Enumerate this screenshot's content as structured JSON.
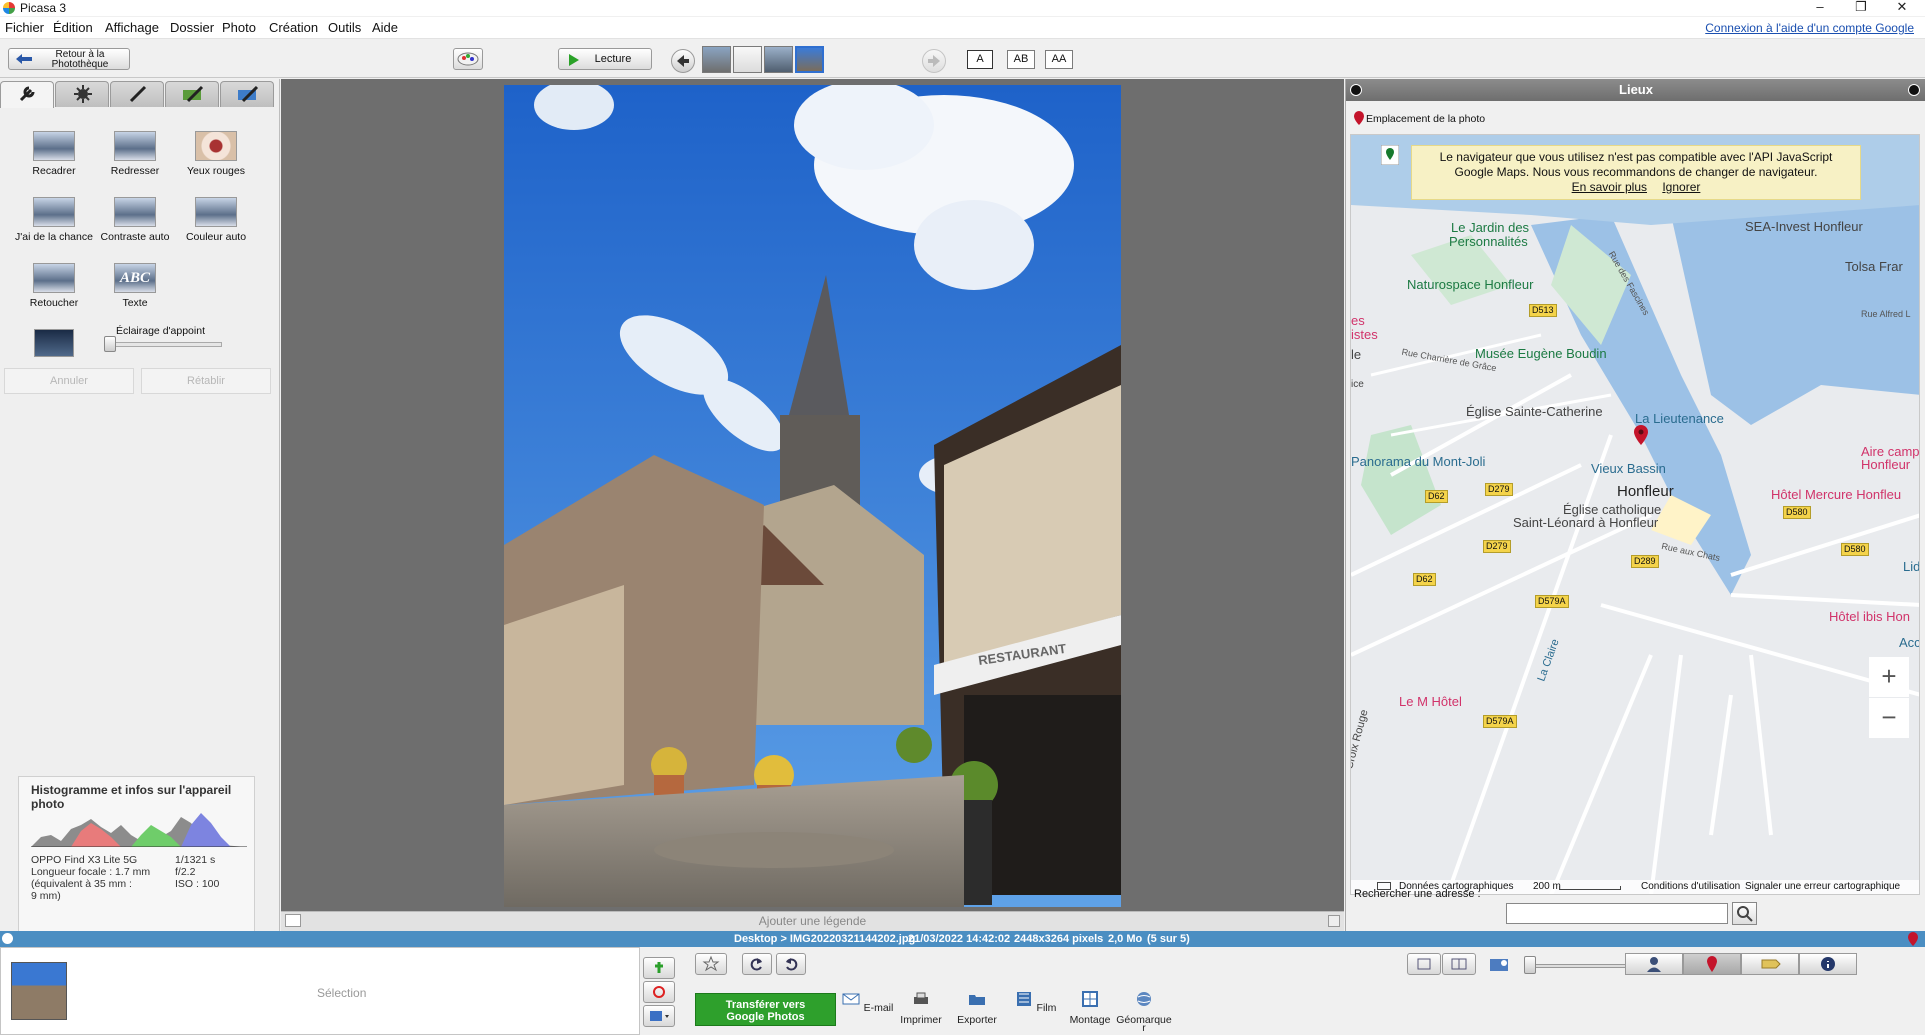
{
  "window": {
    "title": "Picasa 3",
    "buttons": {
      "minimize": "–",
      "maximize": "❐",
      "close": "✕"
    }
  },
  "menu": {
    "items": [
      "Fichier",
      "Édition",
      "Affichage",
      "Dossier",
      "Photo",
      "Création",
      "Outils",
      "Aide"
    ],
    "login_link": "Connexion à l'aide d'un compte Google"
  },
  "toolbar": {
    "back_label_line1": "Retour à la",
    "back_label_line2": "Photothèque",
    "play_label": "Lecture",
    "caption_buttons": [
      "A",
      "AB",
      "AA"
    ]
  },
  "tools": {
    "items": [
      "Recadrer",
      "Redresser",
      "Yeux rouges",
      "J'ai de la chance",
      "Contraste auto",
      "Couleur auto",
      "Retoucher",
      "Texte"
    ],
    "fill_light_label": "Éclairage d'appoint",
    "fill_light_value": 0,
    "undo": "Annuler",
    "redo": "Rétablir"
  },
  "histogram": {
    "title": "Histogramme et infos sur l'appareil photo",
    "camera": "OPPO Find X3 Lite 5G",
    "shutter": "1/1321 s",
    "focal": "Longueur focale : 1.7 mm",
    "aperture": "f/2.2",
    "equiv": "(équivalent à 35 mm :",
    "iso": "ISO : 100",
    "equiv2": "9 mm)"
  },
  "photo": {
    "sign_text": "RESTAURANT"
  },
  "caption_bar": {
    "placeholder": "Ajouter une légende"
  },
  "places": {
    "title": "Lieux",
    "location_label": "Emplacement de la photo",
    "notice_line1": "Le navigateur que vous utilisez n'est pas compatible avec l'API JavaScript",
    "notice_line2": "Google Maps. Nous vous recommandons de changer de navigateur.",
    "notice_more": "En savoir plus",
    "notice_ignore": "Ignorer",
    "map_labels": {
      "jardin1": "Le Jardin des",
      "jardin2": "Personnalités",
      "sea": "SEA-Invest Honfleur",
      "tolsa": "Tolsa Frar",
      "faisnes": "Rue des Fascines",
      "alfred": "Rue Alfred L",
      "naturospace": "Naturospace Honfleur",
      "es": "es",
      "istes": "istes",
      "musee": "Musée Eugène Boudin",
      "le": "le",
      "charriere": "Rue Charrière de Grâce",
      "ice": "ice",
      "eglise": "Église Sainte-Catherine",
      "lieutenance": "La Lieutenance",
      "aire1": "Aire camp",
      "aire2": "Honfleur",
      "panorama": "Panorama du Mont-Joli",
      "vieux": "Vieux Bassin",
      "honfleur": "Honfleur",
      "mercure": "Hôtel Mercure Honfleu",
      "leonard1": "Église catholique",
      "leonard2": "Saint-Léonard à Honfleur",
      "chats": "Rue aux Chats",
      "lidl": "Lidl",
      "ibis": "Hôtel ibis Hon",
      "acc": "Acc",
      "lem": "Le M Hôtel",
      "croix": "Croix Rouge",
      "claire": "La Claire"
    },
    "roads": [
      "D513",
      "D62",
      "D279",
      "D279",
      "D580",
      "D580",
      "D289",
      "D62",
      "D579A",
      "D579A"
    ],
    "zoom_in": "+",
    "zoom_out": "−",
    "footer": {
      "data": "Données cartographiques",
      "scale": "200 m",
      "terms": "Conditions d'utilisation",
      "report": "Signaler une erreur cartographique"
    },
    "address_label": "Rechercher une adresse :",
    "address_value": ""
  },
  "status": {
    "path": "Desktop > IMG20220321144202.jpg",
    "date": "21/03/2022 14:42:02",
    "dims": "2448x3264 pixels",
    "size": "2,0 Mo",
    "index": "(5 sur 5)"
  },
  "bottom": {
    "selection_label": "Sélection",
    "transfer_line1": "Transférer vers",
    "transfer_line2": "Google Photos",
    "actions": [
      "E-mail",
      "Imprimer",
      "Exporter",
      "Film",
      "Montage",
      "Géomarque"
    ],
    "geomark_suffix": "r"
  }
}
